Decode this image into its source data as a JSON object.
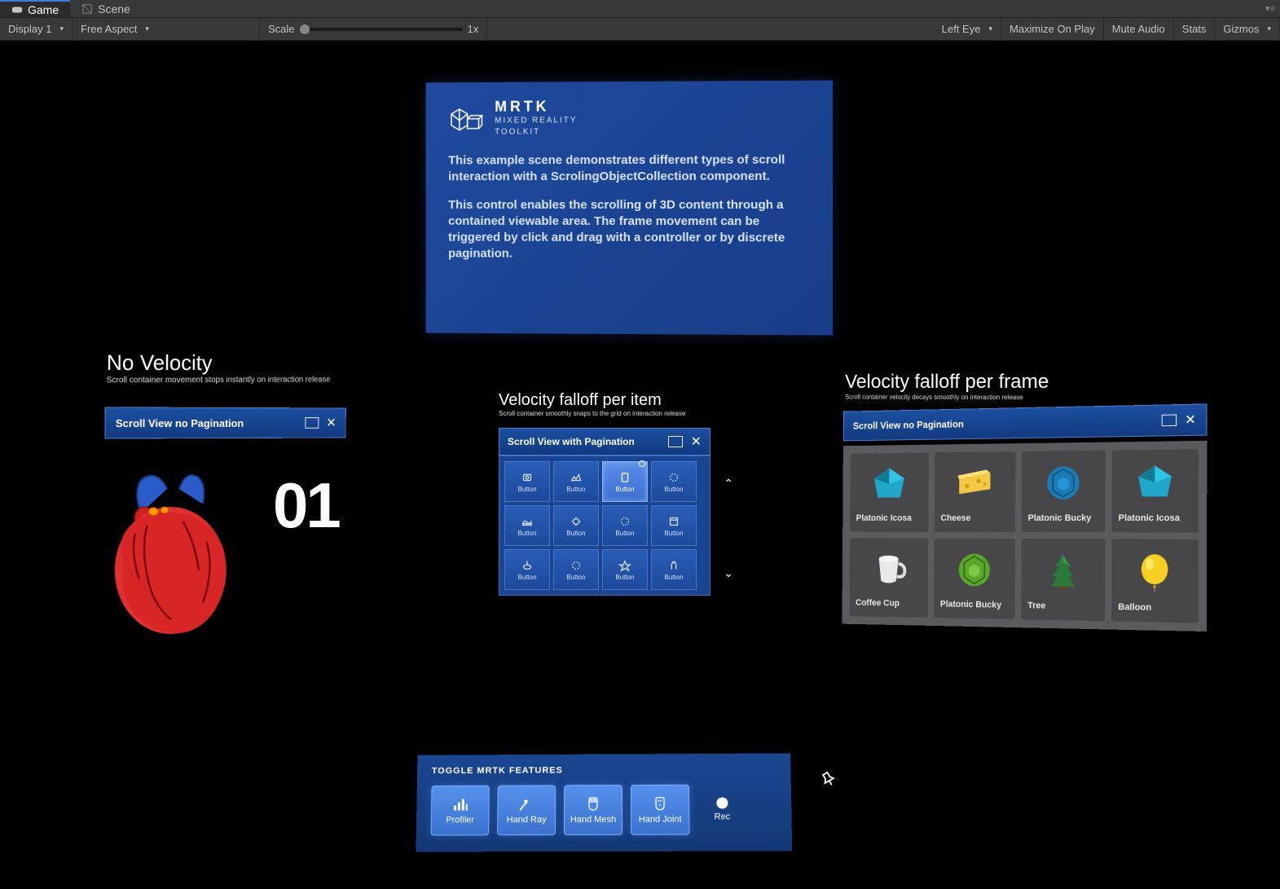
{
  "editor": {
    "tabs": [
      "Game",
      "Scene"
    ],
    "activeTab": "Game",
    "display": "Display 1",
    "aspect": "Free Aspect",
    "scaleLabel": "Scale",
    "scaleValue": "1x",
    "eye": "Left Eye",
    "rightButtons": [
      "Maximize On Play",
      "Mute Audio",
      "Stats",
      "Gizmos"
    ]
  },
  "info": {
    "brand": "MRTK",
    "brandSub1": "MIXED REALITY",
    "brandSub2": "TOOLKIT",
    "p1": "This example scene demonstrates different types of scroll interaction with a ScrolingObjectCollection component.",
    "p2": "This control enables the scrolling of 3D content through a contained viewable area. The frame movement can be triggered by click and drag with a controller or by discrete pagination."
  },
  "sections": {
    "noVelocity": {
      "title": "No Velocity",
      "sub": "Scroll container movement stops instantly on interaction release",
      "bar": "Scroll View no Pagination",
      "bigNumber": "01"
    },
    "perItem": {
      "title": "Velocity falloff per item",
      "sub": "Scroll container smoothly snaps to the grid on interaction release",
      "bar": "Scroll View with Pagination"
    },
    "perFrame": {
      "title": "Velocity falloff per frame",
      "sub": "Scroll container velocity decays smoothly on interaction release",
      "bar": "Scroll View no Pagination"
    }
  },
  "grid": {
    "buttonLabel": "Button",
    "activeIndex": 2
  },
  "gallery": {
    "items": [
      {
        "label": "Platonic Icosa",
        "shape": "icosa-teal"
      },
      {
        "label": "Cheese",
        "shape": "cheese"
      },
      {
        "label": "Platonic Bucky",
        "shape": "bucky-blue"
      },
      {
        "label": "Platonic Icosa",
        "shape": "icosa-teal"
      },
      {
        "label": "Coffee Cup",
        "shape": "cup"
      },
      {
        "label": "Platonic Bucky",
        "shape": "bucky-green"
      },
      {
        "label": "Tree",
        "shape": "tree"
      },
      {
        "label": "Balloon",
        "shape": "balloon"
      }
    ]
  },
  "toggle": {
    "title": "TOGGLE MRTK FEATURES",
    "buttons": [
      "Profiler",
      "Hand Ray",
      "Hand Mesh",
      "Hand Joint"
    ],
    "rec": "Rec"
  }
}
